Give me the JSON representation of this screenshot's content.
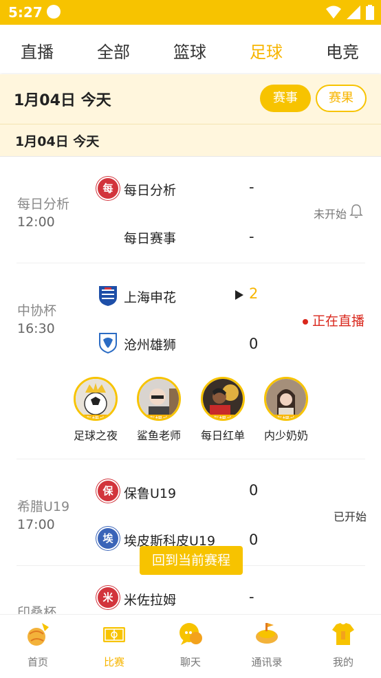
{
  "status_bar": {
    "time": "5:27"
  },
  "top_tabs": [
    {
      "label": "直播"
    },
    {
      "label": "全部"
    },
    {
      "label": "篮球"
    },
    {
      "label": "足球",
      "active": true
    },
    {
      "label": "电竞"
    }
  ],
  "date_header": {
    "date": "1月04日  今天",
    "events_btn": "赛事",
    "results_btn": "赛果"
  },
  "sub_date": "1月04日   今天",
  "matches": [
    {
      "league": "每日分析",
      "time": "12:00",
      "home": "每日分析",
      "away": "每日赛事",
      "home_score": "-",
      "away_score": "-",
      "status": "未开始"
    },
    {
      "league": "中协杯",
      "time": "16:30",
      "home": "上海申花",
      "away": "沧州雄狮",
      "home_score": "2",
      "away_score": "0",
      "status": "正在直播",
      "streamers": [
        {
          "name": "足球之夜",
          "badge": "直播中"
        },
        {
          "name": "鲨鱼老师",
          "badge": "直播中"
        },
        {
          "name": "每日红单",
          "badge": "直播中"
        },
        {
          "name": "内少奶奶",
          "badge": "直播中"
        }
      ]
    },
    {
      "league": "希腊U19",
      "time": "17:00",
      "home": "保鲁U19",
      "away": "埃皮斯科皮U19",
      "home_score": "0",
      "away_score": "0",
      "status": "已开始"
    },
    {
      "league": "印桑杯",
      "home": "米佐拉姆",
      "home_score": "-"
    }
  ],
  "logo_chars": {
    "m1": "每",
    "m3a": "保",
    "m3b": "埃",
    "m4": "米"
  },
  "float_button": "回到当前赛程",
  "bottom_nav": [
    {
      "label": "首页"
    },
    {
      "label": "比赛",
      "active": true
    },
    {
      "label": "聊天"
    },
    {
      "label": "通讯录"
    },
    {
      "label": "我的"
    }
  ],
  "colors": {
    "accent": "#f7c300",
    "accent_text": "#f7b500",
    "live_red": "#d9271c"
  }
}
